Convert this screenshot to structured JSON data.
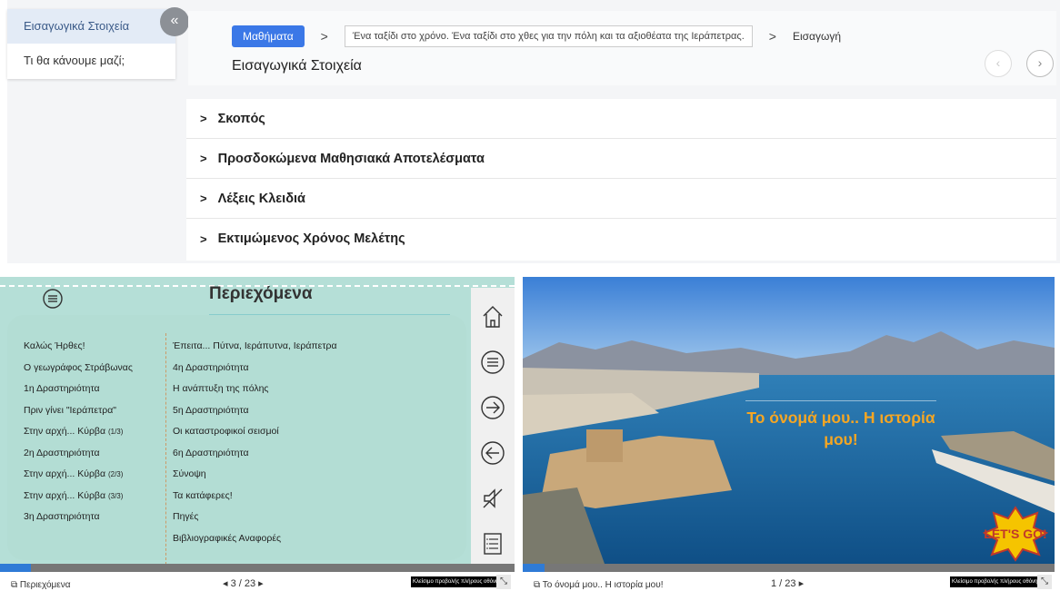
{
  "sidebar": {
    "items": [
      {
        "label": "Εισαγωγικά Στοιχεία"
      },
      {
        "label": "Τι θα κάνουμε μαζί;"
      }
    ],
    "collapse_icon": "«"
  },
  "header": {
    "crumb_button": "Μαθήματα",
    "crumb_sep": ">",
    "crumb_course": "Ένα ταξίδι στο χρόνο. Ένα ταξίδι στο χθες για την πόλη και τα αξιοθέατα της Ιεράπετρας.",
    "crumb_last": "Εισαγωγή",
    "title": "Εισαγωγικά Στοιχεία",
    "prev_icon": "‹",
    "next_icon": "›"
  },
  "accordion": [
    {
      "label": "Σκοπός"
    },
    {
      "label": "Προσδοκώμενα Μαθησιακά Αποτελέσματα"
    },
    {
      "label": "Λέξεις Κλειδιά"
    },
    {
      "label": "Εκτιμώμενος Χρόνος Μελέτης"
    }
  ],
  "slide_contents": {
    "title": "Περιεχόμενα",
    "col1": [
      "Καλώς Ήρθες!",
      "Ο γεωγράφος Στράβωνας",
      "1η Δραστηριότητα",
      "Πριν γίνει \"Ιεράπετρα\"",
      "Στην αρχή... Κύρβα",
      "2η Δραστηριότητα",
      "Στην αρχή... Κύρβα",
      "Στην αρχή... Κύρβα",
      "3η Δραστηριότητα"
    ],
    "col1_suffix": [
      "",
      "",
      "",
      "",
      "(1/3)",
      "",
      "(2/3)",
      "(3/3)",
      ""
    ],
    "col2": [
      "Έπειτα... Πύτνα, Ιεράπυτνα, Ιεράπετρα",
      "4η Δραστηριότητα",
      "Η ανάπτυξη της πόλης",
      "5η Δραστηριότητα",
      "Οι καταστροφικοί σεισμοί",
      "6η Δραστηριότητα",
      "Σύνοψη",
      "Τα κατάφερες!",
      "Πηγές",
      "Βιβλιογραφικές Αναφορές"
    ],
    "footer_label": "Περιεχόμενα",
    "counter": "◂ 3 / 23 ▸",
    "fullscreen_label": "Κλείσιμο προβολής πλήρους οθόνης",
    "progress_fraction": 0.06
  },
  "slide_photo": {
    "caption": "Το όνομά μου.. Η ιστορία μου!",
    "badge": "LET'S GO!",
    "footer_label": "Το όνομά μου.. Η ιστορία μου!",
    "counter": "1 / 23 ▸",
    "fullscreen_label": "Κλείσιμο προβολής πλήρους οθόνης",
    "progress_fraction": 0.04
  }
}
